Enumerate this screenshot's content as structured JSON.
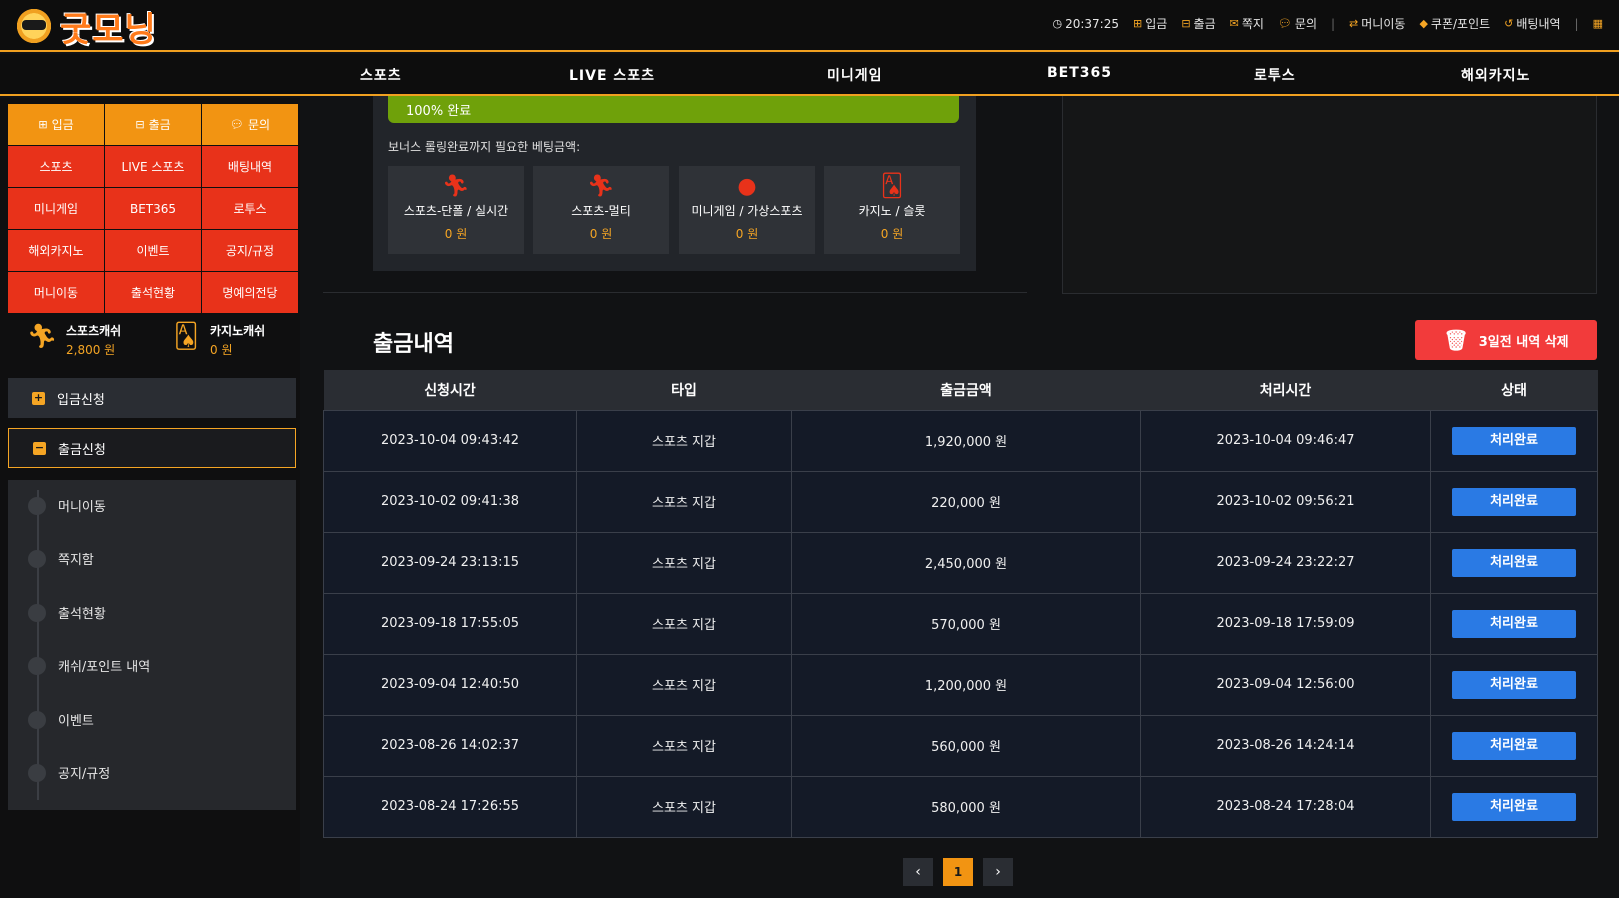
{
  "header": {
    "logo_text": "굿모닝",
    "clock": "20:37:25",
    "links": [
      {
        "icon": "plus-square-icon",
        "label": "입금"
      },
      {
        "icon": "minus-square-icon",
        "label": "출금"
      },
      {
        "icon": "envelope-icon",
        "label": "쪽지"
      },
      {
        "icon": "chat-icon",
        "label": "문의"
      },
      {
        "icon": "transfer-icon",
        "label": "머니이동"
      },
      {
        "icon": "coupon-icon",
        "label": "쿠폰/포인트"
      },
      {
        "icon": "history-icon",
        "label": "배팅내역"
      }
    ]
  },
  "nav": [
    "스포츠",
    "LIVE 스포츠",
    "미니게임",
    "BET365",
    "로투스",
    "해외카지노"
  ],
  "sidebar": {
    "grid": [
      {
        "label": "입금",
        "icon": "plus-square-icon",
        "color": "orange"
      },
      {
        "label": "출금",
        "icon": "minus-square-icon",
        "color": "orange"
      },
      {
        "label": "문의",
        "icon": "chat-icon",
        "color": "orange"
      },
      {
        "label": "스포츠",
        "color": "red"
      },
      {
        "label": "LIVE 스포츠",
        "color": "red"
      },
      {
        "label": "배팅내역",
        "color": "red"
      },
      {
        "label": "미니게임",
        "color": "red"
      },
      {
        "label": "BET365",
        "color": "red"
      },
      {
        "label": "로투스",
        "color": "red"
      },
      {
        "label": "해외카지노",
        "color": "red"
      },
      {
        "label": "이벤트",
        "color": "red"
      },
      {
        "label": "공지/규정",
        "color": "red"
      },
      {
        "label": "머니이동",
        "color": "red"
      },
      {
        "label": "출석현황",
        "color": "red"
      },
      {
        "label": "명예의전당",
        "color": "red"
      }
    ],
    "wallets": [
      {
        "name": "스포츠캐쉬",
        "value": "2,800 원",
        "icon": "runner-icon"
      },
      {
        "name": "카지노캐쉬",
        "value": "0 원",
        "icon": "cards-icon"
      }
    ],
    "deposit_request": "입금신청",
    "withdraw_request": "출금신청",
    "submenu": [
      "머니이동",
      "쪽지함",
      "출석현황",
      "캐쉬/포인트 내역",
      "이벤트",
      "공지/규정"
    ]
  },
  "bonus": {
    "progress_label": "100% 완료",
    "progress_value": 100,
    "required_label": "보너스 롤링완료까지 필요한 베팅금액:",
    "cards": [
      {
        "name": "스포츠-단폴 / 실시간",
        "value": "0 원",
        "icon": "runner-icon"
      },
      {
        "name": "스포츠-멀티",
        "value": "0 원",
        "icon": "runner-icon"
      },
      {
        "name": "미니게임 / 가상스포츠",
        "value": "0 원",
        "icon": "ball-icon"
      },
      {
        "name": "카지노 / 슬롯",
        "value": "0 원",
        "icon": "cards-icon"
      }
    ]
  },
  "withdraw": {
    "title": "출금내역",
    "delete_button": "3일전 내역 삭제",
    "columns": [
      "신청시간",
      "타입",
      "출금금액",
      "처리시간",
      "상태"
    ],
    "rows": [
      {
        "requested": "2023-10-04 09:43:42",
        "type": "스포츠 지갑",
        "amount": "1,920,000 원",
        "processed": "2023-10-04 09:46:47",
        "status": "처리완료"
      },
      {
        "requested": "2023-10-02 09:41:38",
        "type": "스포츠 지갑",
        "amount": "220,000 원",
        "processed": "2023-10-02 09:56:21",
        "status": "처리완료"
      },
      {
        "requested": "2023-09-24 23:13:15",
        "type": "스포츠 지갑",
        "amount": "2,450,000 원",
        "processed": "2023-09-24 23:22:27",
        "status": "처리완료"
      },
      {
        "requested": "2023-09-18 17:55:05",
        "type": "스포츠 지갑",
        "amount": "570,000 원",
        "processed": "2023-09-18 17:59:09",
        "status": "처리완료"
      },
      {
        "requested": "2023-09-04 12:40:50",
        "type": "스포츠 지갑",
        "amount": "1,200,000 원",
        "processed": "2023-09-04 12:56:00",
        "status": "처리완료"
      },
      {
        "requested": "2023-08-26 14:02:37",
        "type": "스포츠 지갑",
        "amount": "560,000 원",
        "processed": "2023-08-26 14:24:14",
        "status": "처리완료"
      },
      {
        "requested": "2023-08-24 17:26:55",
        "type": "스포츠 지갑",
        "amount": "580,000 원",
        "processed": "2023-08-24 17:28:04",
        "status": "처리완료"
      }
    ]
  },
  "pagination": {
    "prev": "‹",
    "current": "1",
    "next": "›"
  },
  "colors": {
    "accent": "#f29412",
    "red": "#e8321a",
    "blue": "#2a7ae4",
    "green": "#6fa10a"
  }
}
